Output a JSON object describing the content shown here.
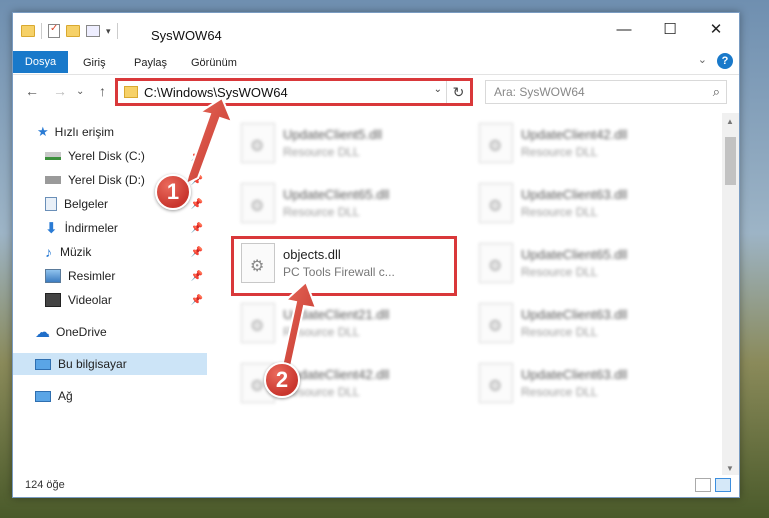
{
  "window": {
    "title": "SysWOW64",
    "controls": {
      "minimize": "—",
      "maximize": "☐",
      "close": "✕"
    }
  },
  "ribbon": {
    "tabs": [
      {
        "label": "Dosya",
        "active": true
      },
      {
        "label": "Giriş"
      },
      {
        "label": "Paylaş"
      },
      {
        "label": "Görünüm"
      }
    ],
    "expand_glyph": "⌄",
    "help_glyph": "?"
  },
  "navigation": {
    "back": "←",
    "forward": "→",
    "recent": "⌄",
    "up": "↑"
  },
  "address_bar": {
    "path": "C:\\Windows\\SysWOW64",
    "dropdown_glyph": "⌄",
    "refresh_glyph": "↻"
  },
  "search": {
    "placeholder": "Ara: SysWOW64",
    "icon": "search-icon"
  },
  "sidebar": {
    "items": [
      {
        "label": "Hızlı erişim",
        "icon": "star-icon",
        "pinned": false
      },
      {
        "label": "Yerel Disk (C:)",
        "icon": "drive-icon",
        "pinned": true
      },
      {
        "label": "Yerel Disk (D:)",
        "icon": "drive-icon",
        "pinned": true
      },
      {
        "label": "Belgeler",
        "icon": "documents-icon",
        "pinned": true
      },
      {
        "label": "İndirmeler",
        "icon": "download-icon",
        "pinned": true
      },
      {
        "label": "Müzik",
        "icon": "music-icon",
        "pinned": true
      },
      {
        "label": "Resimler",
        "icon": "pictures-icon",
        "pinned": true
      },
      {
        "label": "Videolar",
        "icon": "video-icon",
        "pinned": true
      },
      {
        "label": "OneDrive",
        "icon": "cloud-icon",
        "pinned": false
      },
      {
        "label": "Bu bilgisayar",
        "icon": "computer-icon",
        "pinned": false,
        "selected": true
      },
      {
        "label": "Ağ",
        "icon": "network-icon",
        "pinned": false
      }
    ]
  },
  "files": [
    {
      "name": "UpdateClient5.dll",
      "desc": "Resource DLL",
      "blurred": true
    },
    {
      "name": "UpdateClient42.dll",
      "desc": "Resource DLL",
      "blurred": true
    },
    {
      "name": "UpdateClient65.dll",
      "desc": "Resource DLL",
      "blurred": true
    },
    {
      "name": "UpdateClient63.dll",
      "desc": "Resource DLL",
      "blurred": true
    },
    {
      "name": "objects.dll",
      "desc": "PC Tools Firewall c...",
      "blurred": false
    },
    {
      "name": "UpdateClient65.dll",
      "desc": "Resource DLL",
      "blurred": true
    },
    {
      "name": "UpdateClient21.dll",
      "desc": "Resource DLL",
      "blurred": true
    },
    {
      "name": "UpdateClient63.dll",
      "desc": "Resource DLL",
      "blurred": true
    },
    {
      "name": "UpdateClient42.dll",
      "desc": "Resource DLL",
      "blurred": true
    },
    {
      "name": "UpdateClient63.dll",
      "desc": "Resource DLL",
      "blurred": true
    }
  ],
  "status": {
    "item_count": "124 öğe"
  },
  "annotations": {
    "step1": "1",
    "step2": "2",
    "highlight_color": "#d9383a"
  }
}
